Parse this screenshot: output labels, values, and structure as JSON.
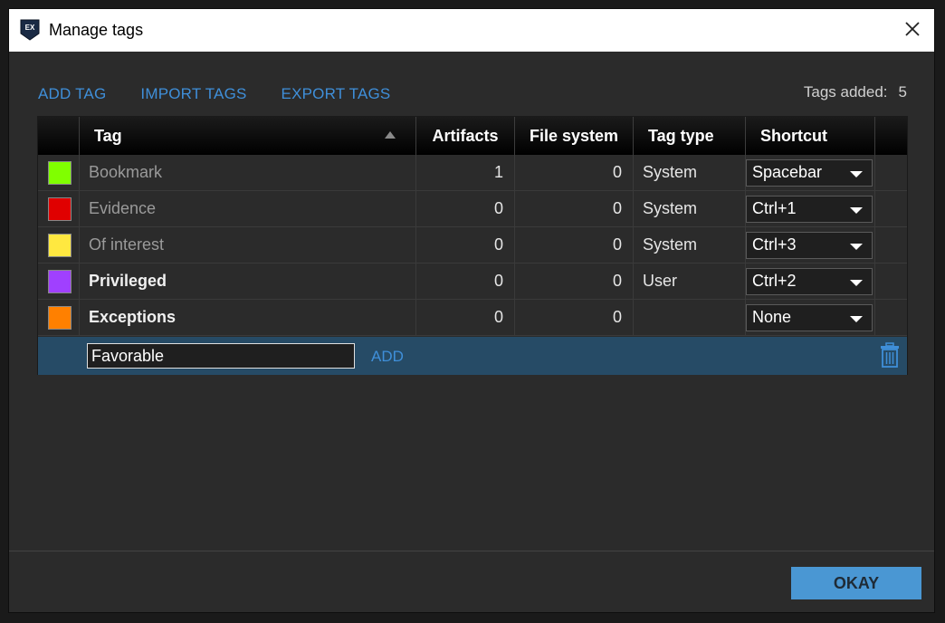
{
  "window": {
    "title": "Manage tags",
    "app_icon_text": "EX"
  },
  "toolbar": {
    "add_tag": "ADD TAG",
    "import_tags": "IMPORT TAGS",
    "export_tags": "EXPORT TAGS",
    "tags_added_label": "Tags added:",
    "tags_added_count": "5"
  },
  "table": {
    "columns": [
      "Tag",
      "Artifacts",
      "File system",
      "Tag type",
      "Shortcut"
    ],
    "rows": [
      {
        "color": "#80ff00",
        "tag": "Bookmark",
        "artifacts": "1",
        "file_system": "0",
        "tag_type": "System",
        "shortcut": "Spacebar"
      },
      {
        "color": "#e00000",
        "tag": "Evidence",
        "artifacts": "0",
        "file_system": "0",
        "tag_type": "System",
        "shortcut": "Ctrl+1"
      },
      {
        "color": "#ffe840",
        "tag": "Of interest",
        "artifacts": "0",
        "file_system": "0",
        "tag_type": "System",
        "shortcut": "Ctrl+3"
      },
      {
        "color": "#a040ff",
        "tag": "Privileged",
        "artifacts": "0",
        "file_system": "0",
        "tag_type": "User",
        "shortcut": "Ctrl+2"
      },
      {
        "color": "#ff8000",
        "tag": "Exceptions",
        "artifacts": "0",
        "file_system": "0",
        "tag_type": "",
        "shortcut": "None"
      }
    ],
    "new_tag": {
      "value": "Favorable",
      "add_label": "ADD"
    }
  },
  "footer": {
    "okay_label": "OKAY"
  },
  "colors": {
    "accent": "#3f8fd9",
    "selected_row": "#264b66",
    "button": "#4a97d3"
  }
}
